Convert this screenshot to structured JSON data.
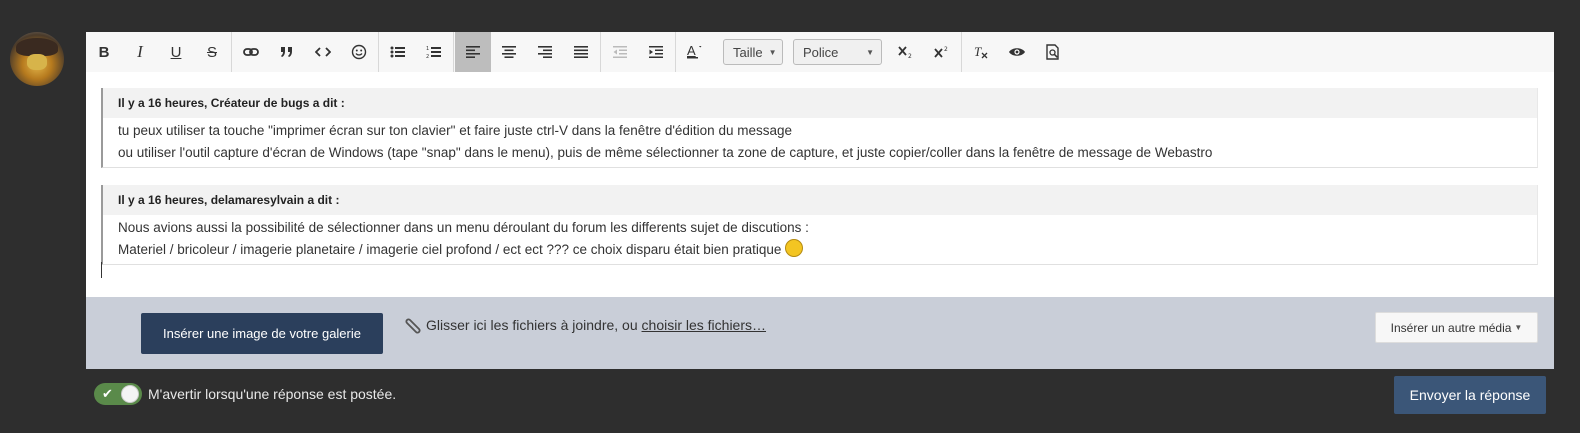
{
  "toolbar": {
    "buttons": [
      {
        "name": "bold-button",
        "glyph": "B"
      },
      {
        "name": "italic-button",
        "glyph": "I"
      },
      {
        "name": "underline-button",
        "glyph": "U"
      },
      {
        "name": "strikethrough-button",
        "glyph": "S"
      }
    ],
    "size_select": "Taille",
    "font_select": "Police"
  },
  "quotes": [
    {
      "header": "Il y a 16 heures, Créateur de bugs a dit :",
      "lines": [
        "tu peux utiliser ta touche \"imprimer écran sur ton clavier\" et faire juste ctrl-V dans la fenêtre d'édition du message",
        "ou utiliser l'outil capture d'écran de Windows (tape \"snap\" dans le menu), puis de même sélectionner ta zone de capture, et juste copier/coller dans la fenêtre de message de Webastro"
      ]
    },
    {
      "header": "Il y a 16 heures, delamaresylvain a dit :",
      "lines": [
        "Nous avions aussi la possibilité de sélectionner dans un menu déroulant du forum les differents sujet de discutions :",
        "Materiel / bricoleur / imagerie planetaire / imagerie ciel profond /  ect ect ??? ce choix disparu était bien pratique"
      ],
      "smiley": "wink-smiley"
    }
  ],
  "attachments": {
    "gallery_button": "Insérer une image de votre galerie",
    "drop_text": "Glisser ici les fichiers à joindre, ou ",
    "drop_link": "choisir les fichiers…",
    "media_button": "Insérer un autre média"
  },
  "footer": {
    "notify_label": "M'avertir lorsqu'une réponse est postée.",
    "notify_enabled": true,
    "send_button": "Envoyer la réponse"
  },
  "colors": {
    "background": "#2e2e2e",
    "primary_button": "#2b3f5c",
    "send_button": "#3b5678",
    "toggle_on": "#5a8a4a",
    "attach_bar": "#c9ced8"
  }
}
